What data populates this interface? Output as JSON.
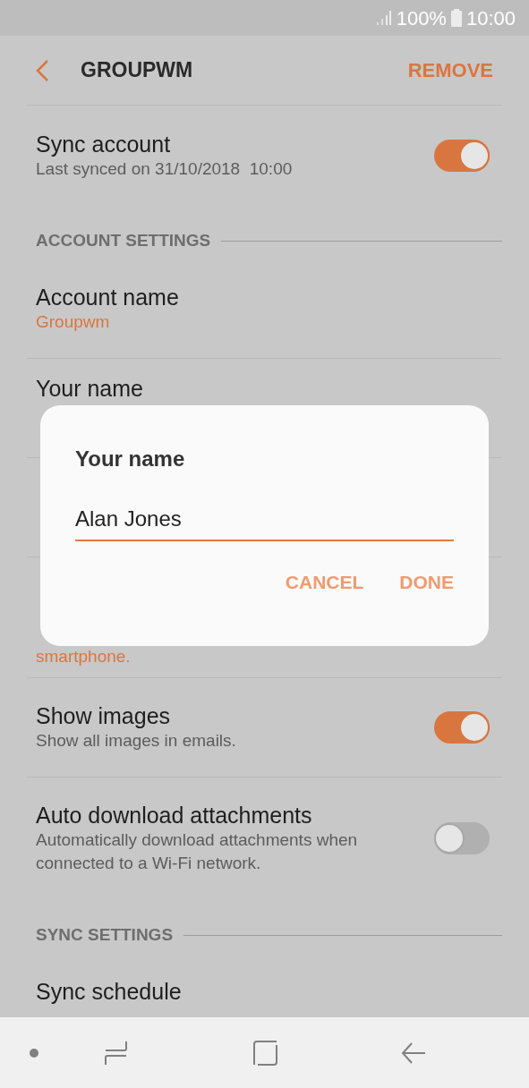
{
  "status_bar": {
    "battery": "100%",
    "time": "10:00"
  },
  "header": {
    "title": "GROUPWM",
    "action": "REMOVE"
  },
  "settings": [
    {
      "kind": "toggle",
      "title": "Sync account",
      "lines": [
        "Last synced on 31/10/2018  10:00"
      ],
      "on": true
    },
    {
      "kind": "section",
      "title": "ACCOUNT SETTINGS"
    },
    {
      "kind": "value",
      "title": "Account name",
      "lines": [
        "Groupwm"
      ]
    },
    {
      "kind": "value",
      "title": "Your name"
    },
    {
      "kind": "covered"
    },
    {
      "kind": "covered",
      "lines": [
        "smartphone."
      ]
    },
    {
      "kind": "toggle",
      "title": "Show images",
      "lines": [
        "Show all images in emails."
      ],
      "on": true
    },
    {
      "kind": "toggle",
      "title": "Auto download attachments",
      "lines": [
        "Automatically download attachments when",
        "connected to a Wi-Fi network."
      ],
      "on": false
    },
    {
      "kind": "section",
      "title": "SYNC SETTINGS"
    },
    {
      "kind": "value",
      "title": "Sync schedule"
    }
  ],
  "dialog": {
    "title": "Your name",
    "value": "Alan Jones",
    "buttons": [
      "CANCEL",
      "DONE"
    ]
  }
}
